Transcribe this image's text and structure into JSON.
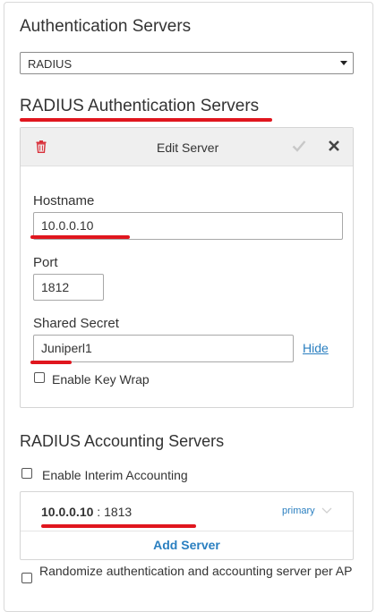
{
  "auth_servers": {
    "title": "Authentication Servers",
    "select_value": "RADIUS"
  },
  "radius_auth": {
    "title": "RADIUS Authentication Servers",
    "edit_server": {
      "header_title": "Edit Server",
      "delete_icon": "trash-icon",
      "confirm_icon": "check-icon",
      "close_icon": "close-icon",
      "hostname_label": "Hostname",
      "hostname_value": "10.0.0.10",
      "port_label": "Port",
      "port_value": "1812",
      "secret_label": "Shared Secret",
      "secret_value": "Juniperl1",
      "hide_link": "Hide",
      "key_wrap_label": "Enable Key Wrap"
    }
  },
  "radius_acct": {
    "title": "RADIUS Accounting Servers",
    "interim_label": "Enable Interim Accounting",
    "server_host": "10.0.0.10",
    "server_sep": " : ",
    "server_port": "1813",
    "server_badge": "primary",
    "add_server_label": "Add Server"
  },
  "randomize_label": "Randomize authentication and accounting server per AP",
  "colors": {
    "accent_link": "#2a7fc0",
    "annotation_red": "#e0161e",
    "delete_red": "#d9303a"
  }
}
